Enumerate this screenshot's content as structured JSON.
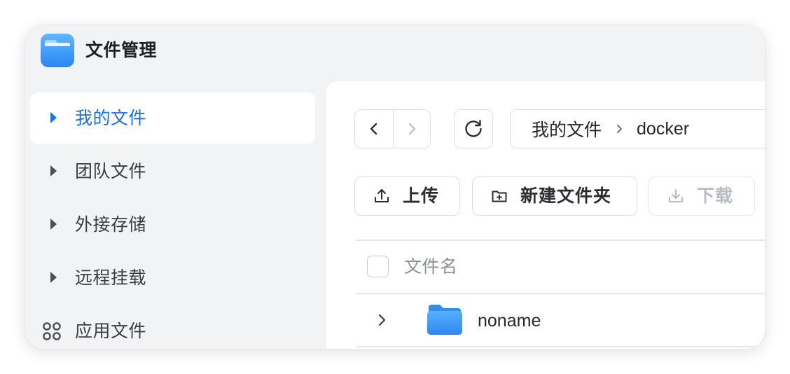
{
  "app": {
    "title": "文件管理",
    "icon": "folder-app-icon"
  },
  "sidebar": {
    "items": [
      {
        "label": "我的文件",
        "icon": "caret-right-icon",
        "active": true
      },
      {
        "label": "团队文件",
        "icon": "caret-right-icon",
        "active": false
      },
      {
        "label": "外接存储",
        "icon": "caret-right-icon",
        "active": false
      },
      {
        "label": "远程挂载",
        "icon": "caret-right-icon",
        "active": false
      },
      {
        "label": "应用文件",
        "icon": "app-grid-icon",
        "active": false
      }
    ]
  },
  "toolbar": {
    "back_icon": "chevron-left-icon",
    "forward_icon": "chevron-right-icon",
    "refresh_icon": "refresh-icon",
    "breadcrumb": [
      "我的文件",
      "docker"
    ],
    "upload_label": "上传",
    "new_folder_label": "新建文件夹",
    "download_label": "下载"
  },
  "table": {
    "column_name": "文件名",
    "rows": [
      {
        "name": "noname",
        "type": "folder"
      }
    ]
  },
  "colors": {
    "accent": "#1a6fe6",
    "sidebar_bg": "#f2f3f5",
    "border": "#dcdee3",
    "folder": "#3a98f7"
  }
}
